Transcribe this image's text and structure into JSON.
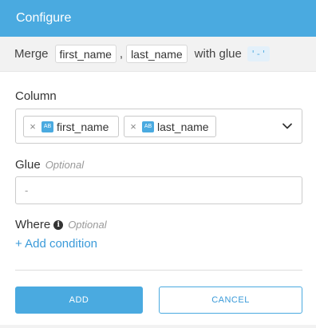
{
  "header": {
    "title": "Configure"
  },
  "summary": {
    "prefix": "Merge",
    "chips": [
      "first_name",
      "last_name"
    ],
    "separator": ",",
    "glue_text": "with glue",
    "glue_value": "'-'"
  },
  "column": {
    "label": "Column",
    "tags": [
      {
        "remove": "×",
        "type": "AB",
        "label": "first_name"
      },
      {
        "remove": "×",
        "type": "AB",
        "label": "last_name"
      }
    ]
  },
  "glue": {
    "label": "Glue",
    "optional": "Optional",
    "placeholder": "-"
  },
  "where": {
    "label": "Where",
    "optional": "Optional",
    "info": "i",
    "add_condition": "+ Add condition"
  },
  "buttons": {
    "add": "ADD",
    "cancel": "CANCEL"
  },
  "colors": {
    "accent": "#4aaae0",
    "link": "#3a9ad9"
  }
}
